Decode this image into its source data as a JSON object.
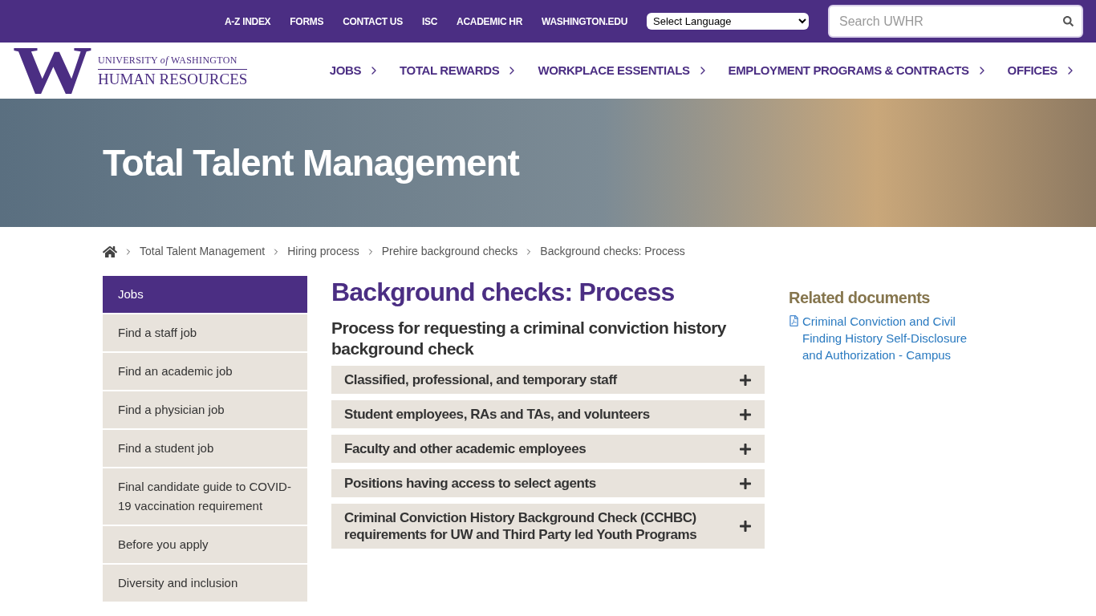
{
  "utility_links": [
    "A-Z INDEX",
    "FORMS",
    "CONTACT US",
    "ISC",
    "ACADEMIC HR",
    "WASHINGTON.EDU"
  ],
  "language_select": {
    "value": "Select Language"
  },
  "search": {
    "placeholder": "Search UWHR"
  },
  "logo": {
    "mark": "W",
    "line1": "UNIVERSITY *of* WASHINGTON",
    "line2": "HUMAN RESOURCES"
  },
  "main_nav": [
    "JOBS",
    "TOTAL REWARDS",
    "WORKPLACE ESSENTIALS",
    "EMPLOYMENT PROGRAMS & CONTRACTS",
    "OFFICES"
  ],
  "hero": {
    "title": "Total Talent Management"
  },
  "breadcrumb": [
    "Total Talent Management",
    "Hiring process",
    "Prehire background checks",
    "Background checks: Process"
  ],
  "sidebar": {
    "items": [
      {
        "label": "Jobs",
        "selected": true
      },
      {
        "label": "Find a staff job",
        "selected": false
      },
      {
        "label": "Find an academic job",
        "selected": false
      },
      {
        "label": "Find a physician job",
        "selected": false
      },
      {
        "label": "Find a student job",
        "selected": false
      },
      {
        "label": "Final candidate guide to COVID-19 vaccination requirement",
        "selected": false
      },
      {
        "label": "Before you apply",
        "selected": false
      },
      {
        "label": "Diversity and inclusion",
        "selected": false
      }
    ]
  },
  "page": {
    "title": "Background checks: Process",
    "subtitle": "Process for requesting a criminal conviction history background check",
    "accordion": [
      {
        "label": "Classified, professional, and temporary staff",
        "expanded": false
      },
      {
        "label": "Student employees, RAs and TAs, and volunteers",
        "expanded": false
      },
      {
        "label": "Faculty and other academic employees",
        "expanded": false
      },
      {
        "label": "Positions having access to select agents",
        "expanded": false
      },
      {
        "label": "Criminal Conviction History Background Check (CCHBC) requirements for UW and Third Party led Youth Programs",
        "expanded": false
      }
    ]
  },
  "related": {
    "heading": "Related documents",
    "links": [
      "Criminal Conviction and Civil Finding History Self-Disclosure and Authorization - Campus"
    ]
  }
}
